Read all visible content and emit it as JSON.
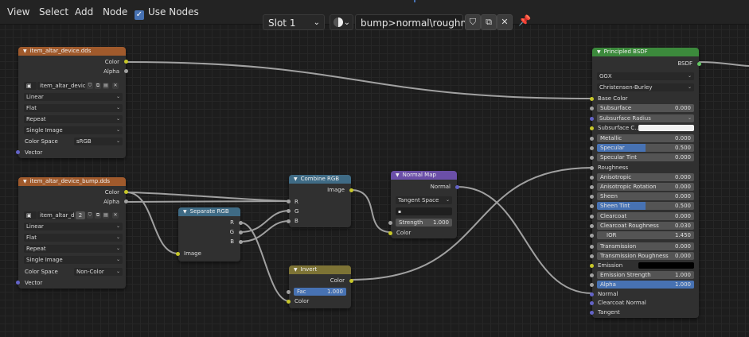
{
  "menu": {
    "view": "View",
    "select": "Select",
    "add": "Add",
    "node": "Node",
    "use_nodes": "Use Nodes"
  },
  "toolbar": {
    "slot": "Slot 1",
    "material": "bump>normal\\roughness"
  },
  "colors": {
    "accent": "#4772b3",
    "color_socket": "#c7c729",
    "float_socket": "#a1a1a1",
    "vector_socket": "#6363c7",
    "shader_socket": "#63c763"
  },
  "node_tex1": {
    "title": "item_altar_device.dds",
    "out_color": "Color",
    "out_alpha": "Alpha",
    "image_name": "item_altar_devic...",
    "interp": "Linear",
    "proj": "Flat",
    "ext": "Repeat",
    "source": "Single Image",
    "cs_label": "Color Space",
    "cs_value": "sRGB",
    "in_vector": "Vector"
  },
  "node_tex2": {
    "title": "item_altar_device_bump.dds",
    "out_color": "Color",
    "out_alpha": "Alpha",
    "image_name": "item_altar_d...",
    "users": "2",
    "interp": "Linear",
    "proj": "Flat",
    "ext": "Repeat",
    "source": "Single Image",
    "cs_label": "Color Space",
    "cs_value": "Non-Color",
    "in_vector": "Vector"
  },
  "node_sep": {
    "title": "Separate RGB",
    "r": "R",
    "g": "G",
    "b": "B",
    "in_image": "Image"
  },
  "node_comb": {
    "title": "Combine RGB",
    "out_image": "Image",
    "r": "R",
    "g": "G",
    "b": "B"
  },
  "node_invert": {
    "title": "Invert",
    "out_color": "Color",
    "fac_label": "Fac",
    "fac_value": "1.000",
    "fac_fraction": 1.0,
    "in_color": "Color"
  },
  "node_normal": {
    "title": "Normal Map",
    "out_normal": "Normal",
    "space": "Tangent Space",
    "uv": "",
    "strength_label": "Strength",
    "strength_value": "1.000",
    "in_color": "Color"
  },
  "node_bsdf": {
    "title": "Principled BSDF",
    "out": "BSDF",
    "distribution": "GGX",
    "subsurface_method": "Christensen-Burley",
    "base_color": "Base Color",
    "subsurface": {
      "label": "Subsurface",
      "value": "0.000"
    },
    "subsurface_radius": "Subsurface Radius",
    "subsurface_color": "Subsurface C...",
    "metallic": {
      "label": "Metallic",
      "value": "0.000"
    },
    "specular": {
      "label": "Specular",
      "value": "0.500",
      "fraction": 0.5
    },
    "specular_tint": {
      "label": "Specular Tint",
      "value": "0.000"
    },
    "roughness": "Roughness",
    "anisotropic": {
      "label": "Anisotropic",
      "value": "0.000"
    },
    "aniso_rot": {
      "label": "Anisotropic Rotation",
      "value": "0.000"
    },
    "sheen": {
      "label": "Sheen",
      "value": "0.000"
    },
    "sheen_tint": {
      "label": "Sheen Tint",
      "value": "0.500",
      "fraction": 0.5
    },
    "clearcoat": {
      "label": "Clearcoat",
      "value": "0.000"
    },
    "clearcoat_rough": {
      "label": "Clearcoat Roughness",
      "value": "0.030"
    },
    "ior": {
      "label": "IOR",
      "value": "1.450"
    },
    "transmission": {
      "label": "Transmission",
      "value": "0.000"
    },
    "trans_rough": {
      "label": "Transmission Roughness",
      "value": "0.000"
    },
    "emission": "Emission",
    "emission_strength": {
      "label": "Emission Strength",
      "value": "1.000"
    },
    "alpha": {
      "label": "Alpha",
      "value": "1.000",
      "fraction": 1.0
    },
    "normal": "Normal",
    "clearcoat_normal": "Clearcoat Normal",
    "tangent": "Tangent"
  }
}
